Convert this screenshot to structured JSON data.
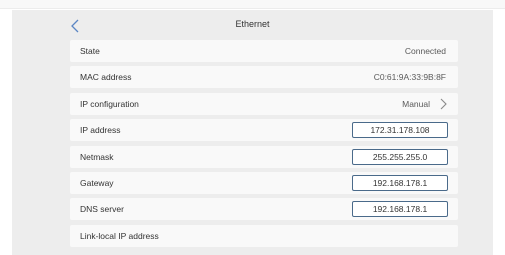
{
  "header": {
    "title": "Ethernet"
  },
  "rows": {
    "state": {
      "label": "State",
      "value": "Connected"
    },
    "mac": {
      "label": "MAC address",
      "value": "C0:61:9A:33:9B:8F"
    },
    "ip_config": {
      "label": "IP configuration",
      "value": "Manual"
    },
    "ip_address": {
      "label": "IP address",
      "value": "172.31.178.108"
    },
    "netmask": {
      "label": "Netmask",
      "value": "255.255.255.0"
    },
    "gateway": {
      "label": "Gateway",
      "value": "192.168.178.1"
    },
    "dns": {
      "label": "DNS server",
      "value": "192.168.178.1"
    },
    "link_local": {
      "label": "Link-local IP address",
      "value": ""
    }
  },
  "colors": {
    "accent": "#4a6a8a",
    "back_icon": "#5b86c4",
    "panel_bg": "#ededed",
    "row_bg": "#f9f9f9"
  },
  "icons": {
    "back": "chevron-left-icon",
    "ip_config": "chevron-right-icon"
  }
}
